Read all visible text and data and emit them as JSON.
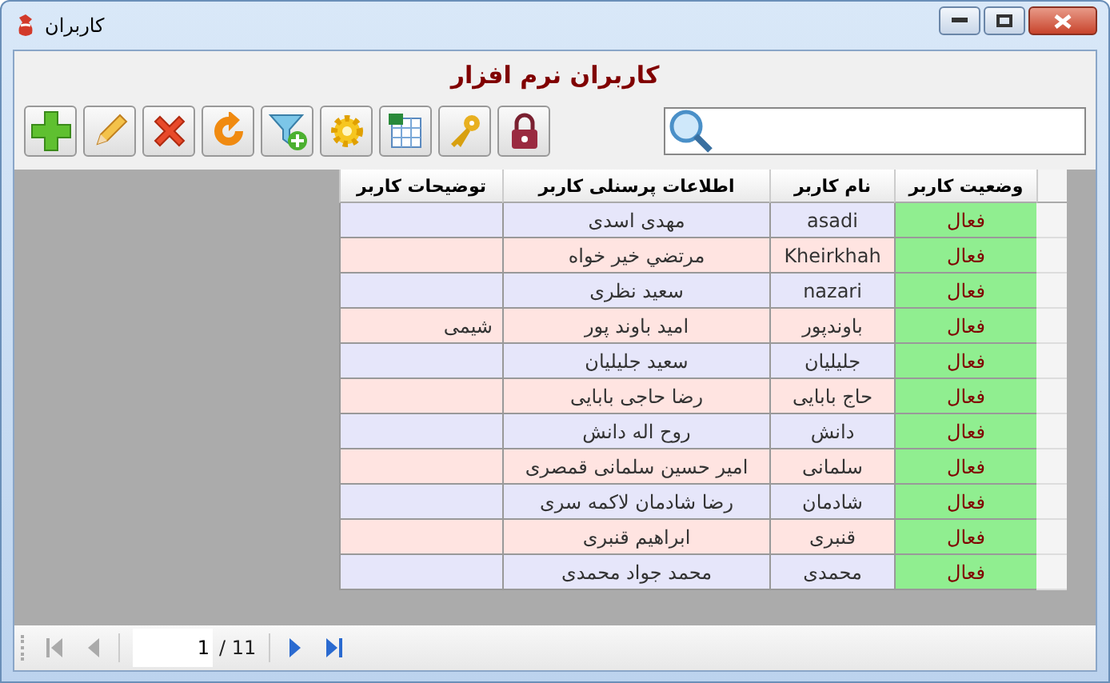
{
  "window": {
    "title": "کاربران"
  },
  "heading": "کاربران نرم افزار",
  "table": {
    "columns": [
      "وضعیت کاربر",
      "نام کاربر",
      "اطلاعات پرسنلی کاربر",
      "توضیحات کاربر"
    ],
    "rows": [
      {
        "status": "فعال",
        "username": "asadi",
        "info": "مهدی  اسدی"
      },
      {
        "status": "فعال",
        "username": "Kheirkhah",
        "info": "مرتضي  خير خواه"
      },
      {
        "status": "فعال",
        "username": "nazari",
        "info": "سعید  نظری"
      },
      {
        "status": "فعال",
        "username": "باوندپور",
        "info": "امید  باوند پور",
        "notes": "شیمی"
      },
      {
        "status": "فعال",
        "username": "جلیلیان",
        "info": "سعید  جلیلیان"
      },
      {
        "status": "فعال",
        "username": "حاج بابایی",
        "info": "رضا  حاجی بابایی"
      },
      {
        "status": "فعال",
        "username": "دانش",
        "info": "روح اله  دانش"
      },
      {
        "status": "فعال",
        "username": "سلمانی",
        "info": "امیر حسین  سلمانی قمصری"
      },
      {
        "status": "فعال",
        "username": "شادمان",
        "info": "رضا  شادمان لاکمه سری"
      },
      {
        "status": "فعال",
        "username": "قنبری",
        "info": "ابراهیم  قنبری"
      },
      {
        "status": "فعال",
        "username": "محمدی",
        "info": "محمد جواد  محمدی"
      }
    ]
  },
  "pager": {
    "page": "1",
    "total": "/ 11"
  }
}
